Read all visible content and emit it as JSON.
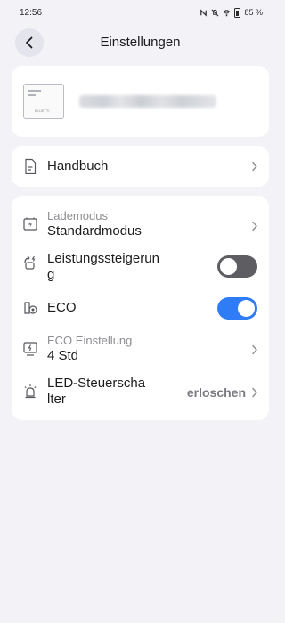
{
  "status_bar": {
    "time": "12:56",
    "battery_text": "85 %",
    "icons": [
      "nfc-icon",
      "mute-icon",
      "wifi-icon",
      "battery-icon"
    ]
  },
  "nav": {
    "title": "Einstellungen",
    "back_icon": "back-arrow-icon"
  },
  "device": {
    "thumb_brand": "BLUETTI",
    "name_blurred": true
  },
  "manual": {
    "label": "Handbuch"
  },
  "settings": {
    "charge_mode": {
      "label": "Lademodus",
      "value": "Standardmodus"
    },
    "power_lifting": {
      "label_line1": "Leistungssteigerun",
      "label_line2": "g",
      "enabled": false
    },
    "eco": {
      "label": "ECO",
      "enabled": true
    },
    "eco_setting": {
      "label": "ECO Einstellung",
      "value": "4 Std"
    },
    "led_switch": {
      "label_line1": "LED-Steuerscha",
      "label_line2": "lter",
      "value": "erloschen"
    }
  },
  "colors": {
    "background": "#f2f2f7",
    "card": "#ffffff",
    "toggle_on": "#2f7cf6",
    "toggle_off": "#5e5e62",
    "secondary_text": "#8e8e93"
  }
}
